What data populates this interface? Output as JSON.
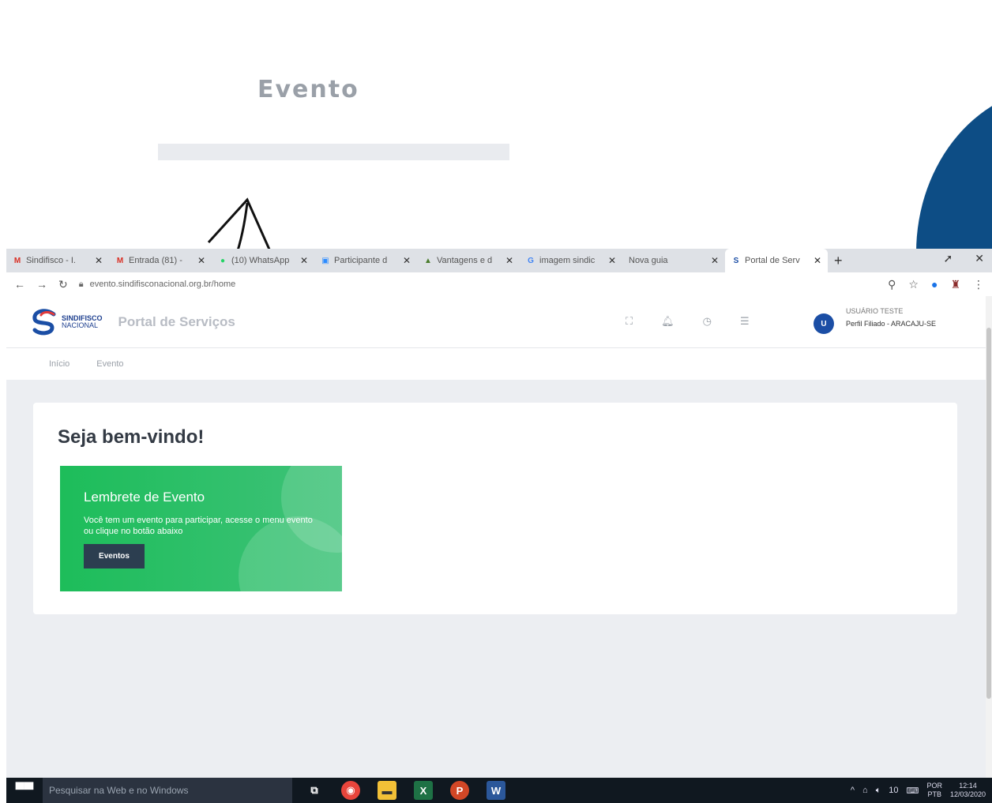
{
  "slide": {
    "title": "Evento"
  },
  "browser": {
    "tabs": [
      {
        "label": "Sindifisco - I.",
        "icon": "gmail-icon",
        "icon_char": "M",
        "color": "#d93025"
      },
      {
        "label": "Entrada (81) -",
        "icon": "gmail-icon",
        "icon_char": "M",
        "color": "#d93025"
      },
      {
        "label": "(10) WhatsApp",
        "icon": "whatsapp-icon",
        "icon_char": "●",
        "color": "#25d366"
      },
      {
        "label": "Participante d",
        "icon": "zoom-icon",
        "icon_char": "▣",
        "color": "#2d8cff"
      },
      {
        "label": "Vantagens e d",
        "icon": "site-icon",
        "icon_char": "▲",
        "color": "#4a7c2c"
      },
      {
        "label": "imagem sindic",
        "icon": "google-icon",
        "icon_char": "G",
        "color": "#4285f4"
      },
      {
        "label": "Nova guia",
        "icon": "",
        "icon_char": "",
        "color": "#555555"
      },
      {
        "label": "Portal de Serv",
        "icon": "sindifisco-icon",
        "icon_char": "S",
        "color": "#1b4ea5",
        "active": true
      }
    ],
    "new_tab": "+",
    "url": "evento.sindifisconacional.org.br/home"
  },
  "app": {
    "logo_line1": "SINDIFISCO",
    "logo_line2": "NACIONAL",
    "portal_title": "Portal de Serviços",
    "user_initial": "U",
    "user_name": "USUÁRIO TESTE",
    "user_dept": "Perfil Filiado - ARACAJU-SE",
    "breadcrumb": [
      "Início",
      "Evento"
    ]
  },
  "content": {
    "welcome": "Seja bem-vindo!",
    "reminder_title": "Lembrete de Evento",
    "reminder_text": "Você tem um evento para participar, acesse o menu evento ou clique no botão abaixo",
    "reminder_button": "Eventos"
  },
  "taskbar": {
    "search_placeholder": "Pesquisar na Web e no Windows",
    "lang_line1": "POR",
    "lang_line2": "PTB",
    "time": "12:14",
    "date": "12/03/2020",
    "volume": "10"
  },
  "colors": {
    "accent_blue": "#0d4d85",
    "reminder_green": "#1dbd5a",
    "button_dark": "#2c3e50"
  }
}
